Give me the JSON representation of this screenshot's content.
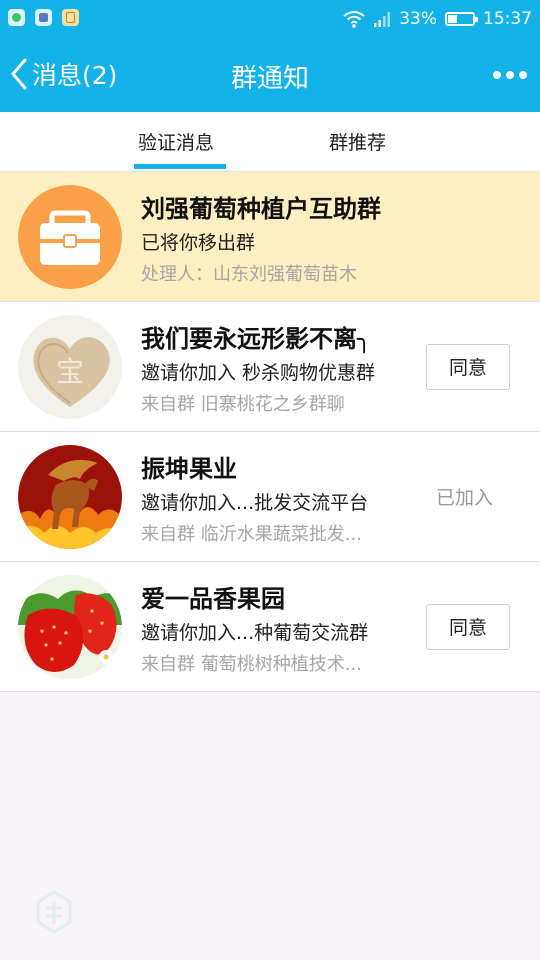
{
  "status_bar": {
    "battery": "33%",
    "battery_level": 0.33,
    "time": "15:37",
    "icons": [
      "app-notification-icon",
      "app-notification-icon",
      "app-notification-icon",
      "wifi-icon",
      "signal-icon",
      "battery-icon"
    ]
  },
  "nav": {
    "back_label": "消息(2)",
    "title": "群通知",
    "more_icon": "more-dots-icon"
  },
  "tabs": [
    {
      "label": "验证消息",
      "active": true
    },
    {
      "label": "群推荐",
      "active": false
    }
  ],
  "notifications": [
    {
      "group_name": "刘强葡萄种植户互助群",
      "message": "已将你移出群",
      "source": "处理人：山东刘强葡萄苗木",
      "action": "",
      "highlighted": true,
      "avatar": "briefcase-icon"
    },
    {
      "group_name": "我们要永远形影不离╮",
      "message": "邀请你加入 秒杀购物优惠群",
      "source": "来自群 旧寨桃花之乡群聊",
      "action": "同意",
      "highlighted": false,
      "avatar": "heart-stone-avatar"
    },
    {
      "group_name": "振坤果业",
      "message": "邀请你加入...批发交流平台",
      "source": "来自群 临沂水果蔬菜批发...",
      "action": "已加入",
      "highlighted": false,
      "avatar": "pegasus-avatar"
    },
    {
      "group_name": "爱一品香果园",
      "message": "邀请你加入...种葡萄交流群",
      "source": "来自群 葡萄桃树种植技术...",
      "action": "同意",
      "highlighted": false,
      "avatar": "strawberry-avatar"
    }
  ],
  "colors": {
    "accent": "#13b3ea",
    "highlight_row": "#fdefc2",
    "background": "#f7f4f8"
  }
}
